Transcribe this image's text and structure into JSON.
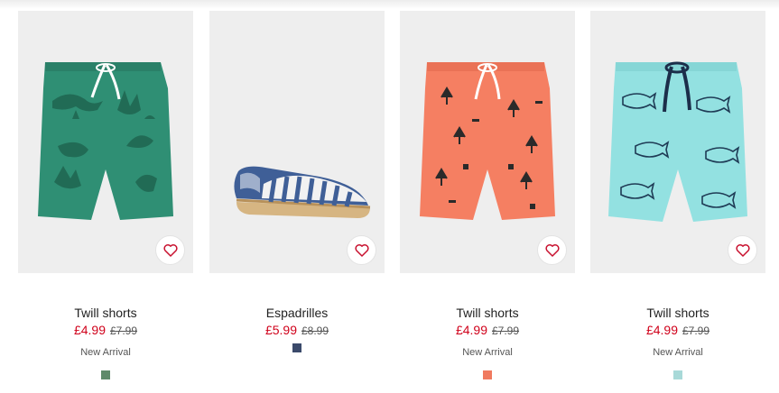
{
  "products": [
    {
      "name": "Twill shorts",
      "sale_price": "£4.99",
      "old_price": "£7.99",
      "badge": "New Arrival",
      "swatch_color": "#5f8a6a",
      "product_color": "#2f8f74",
      "print_color": "#216b55",
      "favorite_icon": "heart-outline-icon"
    },
    {
      "name": "Espadrilles",
      "sale_price": "£5.99",
      "old_price": "£8.99",
      "badge": "",
      "swatch_color": "#3b4a6b",
      "product_color": "#3f5f97",
      "print_color": "#ffffff",
      "favorite_icon": "heart-outline-icon"
    },
    {
      "name": "Twill shorts",
      "sale_price": "£4.99",
      "old_price": "£7.99",
      "badge": "New Arrival",
      "swatch_color": "#f07a5f",
      "product_color": "#f57f62",
      "print_color": "#2a2a2a",
      "favorite_icon": "heart-outline-icon"
    },
    {
      "name": "Twill shorts",
      "sale_price": "£4.99",
      "old_price": "£7.99",
      "badge": "New Arrival",
      "swatch_color": "#a8d9d8",
      "product_color": "#93e1e1",
      "print_color": "#1f3b55",
      "favorite_icon": "heart-outline-icon"
    }
  ],
  "colors": {
    "sale_price": "#d0021b",
    "favorite_heart": "#c8102e",
    "image_background": "#eeeeee"
  }
}
